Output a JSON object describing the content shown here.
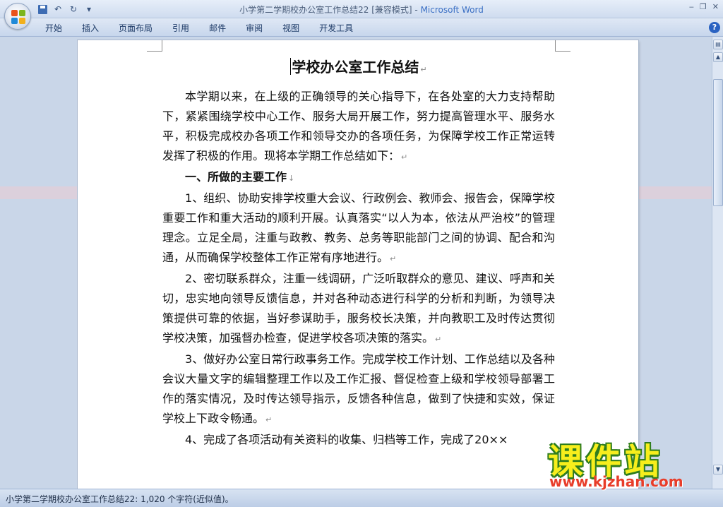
{
  "window": {
    "title": "小学第二学期校办公室工作总结22 [兼容模式]",
    "separator": " - ",
    "app_name": "Microsoft Word"
  },
  "ribbon": {
    "tabs": [
      "开始",
      "插入",
      "页面布局",
      "引用",
      "邮件",
      "审阅",
      "视图",
      "开发工具"
    ]
  },
  "document": {
    "title": "学校办公室工作总结",
    "paragraphs": [
      "本学期以来，在上级的正确领导的关心指导下，在各处室的大力支持帮助下，紧紧围绕学校中心工作、服务大局开展工作，努力提高管理水平、服务水平，积极完成校办各项工作和领导交办的各项任务，为保障学校工作正常运转发挥了积极的作用。现将本学期工作总结如下：",
      "一、所做的主要工作",
      "1、组织、协助安排学校重大会议、行政例会、教师会、报告会，保障学校重要工作和重大活动的顺利开展。认真落实“以人为本，依法从严治校”的管理理念。立足全局，注重与政教、教务、总务等职能部门之间的协调、配合和沟通，从而确保学校整体工作正常有序地进行。",
      "2、密切联系群众，注重一线调研，广泛听取群众的意见、建议、呼声和关切，忠实地向领导反馈信息，并对各种动态进行科学的分析和判断，为领导决策提供可靠的依据，当好参谋助手，服务校长决策，并向教职工及时传达贯彻学校决策，加强督办检查，促进学校各项决策的落实。",
      "3、做好办公室日常行政事务工作。完成学校工作计划、工作总结以及各种会议大量文字的编辑整理工作以及工作汇报、督促检查上级和学校领导部署工作的落实情况，及时传达领导指示，反馈各种信息，做到了快捷和实效，保证学校上下政令畅通。",
      "4、完成了各项活动有关资料的收集、归档等工作，完成了20××"
    ]
  },
  "status_bar": {
    "text": "小学第二学期校办公室工作总结22: 1,020 个字符(近似值)。"
  },
  "watermark": {
    "main": "课件站",
    "url": "www.kjzhan.com"
  },
  "icons": [
    "office-button-icon",
    "save-icon",
    "undo-icon",
    "redo-icon",
    "customize-qat-icon",
    "minimize-icon",
    "restore-icon",
    "close-icon",
    "help-icon",
    "ruler-toggle-icon",
    "scroll-up-icon",
    "scroll-down-icon"
  ]
}
